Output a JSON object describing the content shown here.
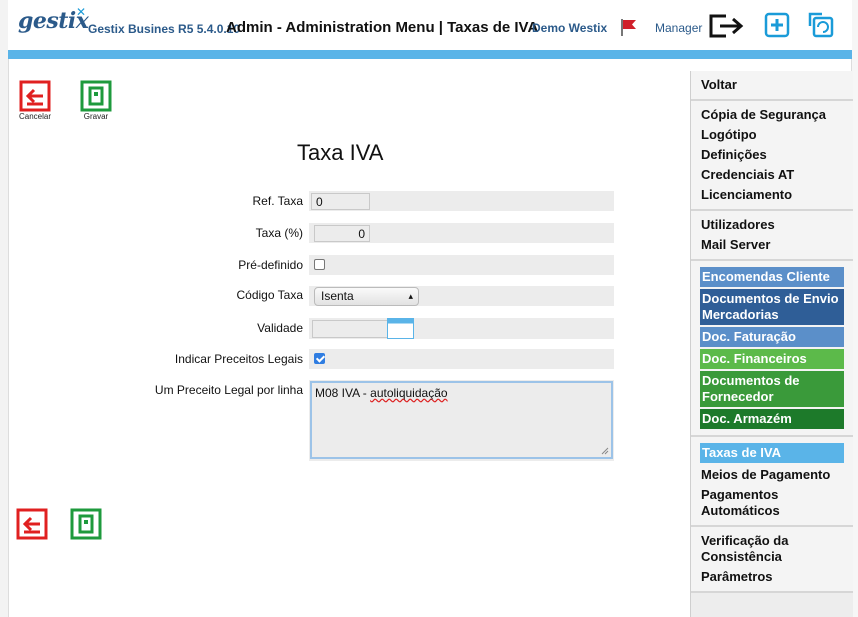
{
  "header": {
    "logo": "gestix",
    "version": "Gestix Busines R5 5.4.0.10",
    "title": "Admin - Administration Menu | Taxas de IVA",
    "company": "Demo Westix",
    "user": "Manager"
  },
  "toolbar": {
    "cancel_label": "Cancelar",
    "save_label": "Gravar"
  },
  "form": {
    "title": "Taxa IVA",
    "ref_label": "Ref. Taxa",
    "ref_value": "0",
    "rate_label": "Taxa (%)",
    "rate_value": "0",
    "default_label": "Pré-definido",
    "default_checked": false,
    "code_label": "Código Taxa",
    "code_value": "Isenta",
    "validity_label": "Validade",
    "validity_value": "",
    "legal_label": "Indicar Preceitos Legais",
    "legal_checked": true,
    "per_line_label": "Um Preceito Legal por linha",
    "per_line_prefix": "M08 IVA - ",
    "per_line_misspelled": "autoliquidação"
  },
  "menu": {
    "groups": [
      {
        "items": [
          {
            "label": "Voltar"
          }
        ]
      },
      {
        "items": [
          {
            "label": "Cópia de Segurança"
          },
          {
            "label": "Logótipo"
          },
          {
            "label": "Definições"
          },
          {
            "label": "Credenciais AT"
          },
          {
            "label": "Licenciamento"
          }
        ]
      },
      {
        "items": [
          {
            "label": "Utilizadores"
          },
          {
            "label": "Mail Server"
          }
        ]
      },
      {
        "items": [
          {
            "label": "Encomendas Cliente",
            "color": "#5b8fc9"
          },
          {
            "label": "Documentos de Envio Mercadorias",
            "color": "#2f5e97"
          },
          {
            "label": "Doc. Faturação",
            "color": "#5b8fc9"
          },
          {
            "label": "Doc. Financeiros",
            "color": "#5cba4a"
          },
          {
            "label": "Documentos de Fornecedor",
            "color": "#3a9a3a"
          },
          {
            "label": "Doc. Armazém",
            "color": "#1d7a2a"
          }
        ]
      },
      {
        "items": [
          {
            "label": "Taxas de IVA",
            "color": "#5ab4e8",
            "active": true
          },
          {
            "label": "Meios de Pagamento"
          },
          {
            "label": "Pagamentos Automáticos"
          }
        ]
      },
      {
        "items": [
          {
            "label": "Verificação da Consistência"
          },
          {
            "label": "Parâmetros"
          }
        ]
      }
    ]
  },
  "colors": {
    "accent_bar": "#5ab4e8",
    "cancel_red": "#e02020",
    "save_green": "#1e9a3c"
  }
}
